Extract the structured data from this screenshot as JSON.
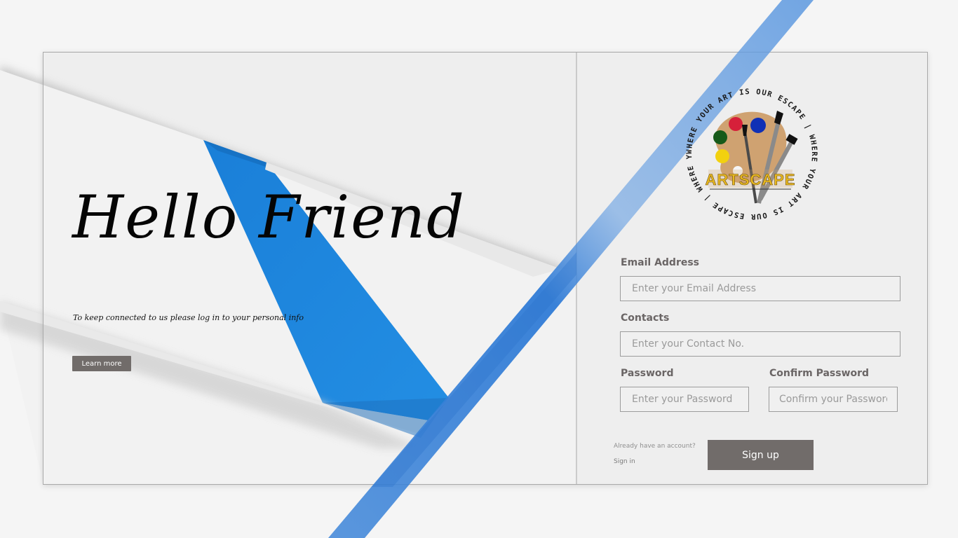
{
  "hero": {
    "title": "Hello Friend",
    "tagline": "To keep connected to us please log in to your personal info",
    "learn_more_label": "Learn more"
  },
  "logo": {
    "brand": "ARTSCAPE",
    "ring_text": "WHERE YOUR ART IS OUR ESCAPE | WHERE YOUR ART IS OUR ESCAPE | WHERE YOUR ART IS OUR ",
    "icon": "palette-icon"
  },
  "form": {
    "email": {
      "label": "Email Address",
      "placeholder": "Enter your Email Address",
      "value": ""
    },
    "contacts": {
      "label": "Contacts",
      "placeholder": "Enter your Contact No.",
      "value": ""
    },
    "password": {
      "label": "Password",
      "placeholder": "Enter your Password",
      "value": ""
    },
    "confirm_password": {
      "label": "Confirm Password",
      "placeholder": "Confirm your Password",
      "value": ""
    },
    "already_text": "Already have an account?",
    "signin_label": "Sign in",
    "signup_label": "Sign up"
  },
  "colors": {
    "accent_blue": "#1e88de",
    "button_gray": "#716c6a",
    "label_gray": "#6a6565",
    "background": "#f5f5f5"
  }
}
